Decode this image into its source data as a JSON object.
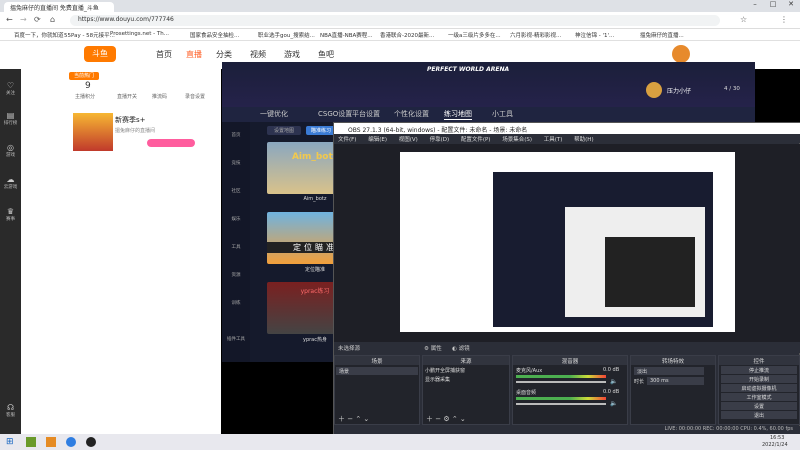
{
  "browser": {
    "tab_title": "搵兔麻仔的直播间 免费直播_斗鱼",
    "url": "https://www.douyu.com/777746",
    "bookmarks": [
      "百度一下，你就知道",
      "55Pay - 58元接平...",
      "Prosettings.net - Th...",
      "国家食品安全抽检...",
      "职业选手gou_搜索结...",
      "NBA直播-NBA赛程...",
      "香港联合-2020最新...",
      "一级a三级片多多在...",
      "六月影视-精彩影视...",
      "神泣信锦 - '1'...",
      "搵兔麻仔的直播..."
    ]
  },
  "douyu": {
    "nav": [
      "首页",
      "直播",
      "分类",
      "视频",
      "游戏",
      "鱼吧"
    ],
    "left_nav": [
      "关注",
      "排行榜",
      "游戏",
      "云游戏",
      "赛事",
      "客服"
    ],
    "stats": {
      "count": "9",
      "label1": "主播积分",
      "label2": "直播开关",
      "label3": "推流码",
      "label4": "录音设置",
      "badge": "当前热门"
    },
    "streamer": "新赛季s+",
    "streamer_sub": "搵兔麻仔的直播间"
  },
  "arena": {
    "title": "PERFECT WORLD ARENA",
    "user": "压力小仔",
    "count": "4 / 30",
    "tabs": [
      "一键优化",
      "CSGO设置",
      "平台设置",
      "个性化设置",
      "练习地图",
      "小工具"
    ],
    "subtabs": [
      "设置地图",
      "瞄准练习"
    ],
    "side_items": [
      "首页",
      "竞技",
      "社区",
      "娱乐",
      "工具",
      "资源",
      "训练",
      "插件工具"
    ],
    "cards": [
      {
        "title": "Aim_botz",
        "name": "Aim_botz"
      },
      {
        "title": "定位瞄准",
        "name": "定位瞄准"
      },
      {
        "title": "yprac练习",
        "name": "yprac热身"
      }
    ]
  },
  "obs": {
    "title": "OBS 27.1.3 (64-bit, windows) - 配置文件: 未命名 - 场景: 未命名",
    "menu": [
      "文件(F)",
      "编辑(E)",
      "视图(V)",
      "停靠(D)",
      "配置文件(P)",
      "场景集合(S)",
      "工具(T)",
      "帮助(H)"
    ],
    "status_bar": {
      "a": "未选择源",
      "b": "属性",
      "c": "滤镜"
    },
    "docks": {
      "scenes": "场景",
      "sources": "来源",
      "mixer": "混音器",
      "transitions": "转场特效",
      "controls": "控件"
    },
    "scene_item": "场景",
    "sources": [
      "小鹏开全屏捕获窗",
      "显示器采集"
    ],
    "mixer": [
      {
        "name": "麦克风/Aux",
        "db": "0.0 dB"
      },
      {
        "name": "桌面音频",
        "db": "0.0 dB"
      }
    ],
    "transition": {
      "type": "淡出",
      "duration_label": "时长",
      "duration": "300 ms"
    },
    "controls": [
      "停止推流",
      "开始录制",
      "启动虚拟摄像机",
      "工作室模式",
      "设置",
      "退出"
    ],
    "statusline": "LIVE: 00:00:00  REC: 00:00:00  CPU: 0.4%, 60.00 fps"
  },
  "taskbar": {
    "time": "16:53",
    "date": "2022/1/24"
  }
}
